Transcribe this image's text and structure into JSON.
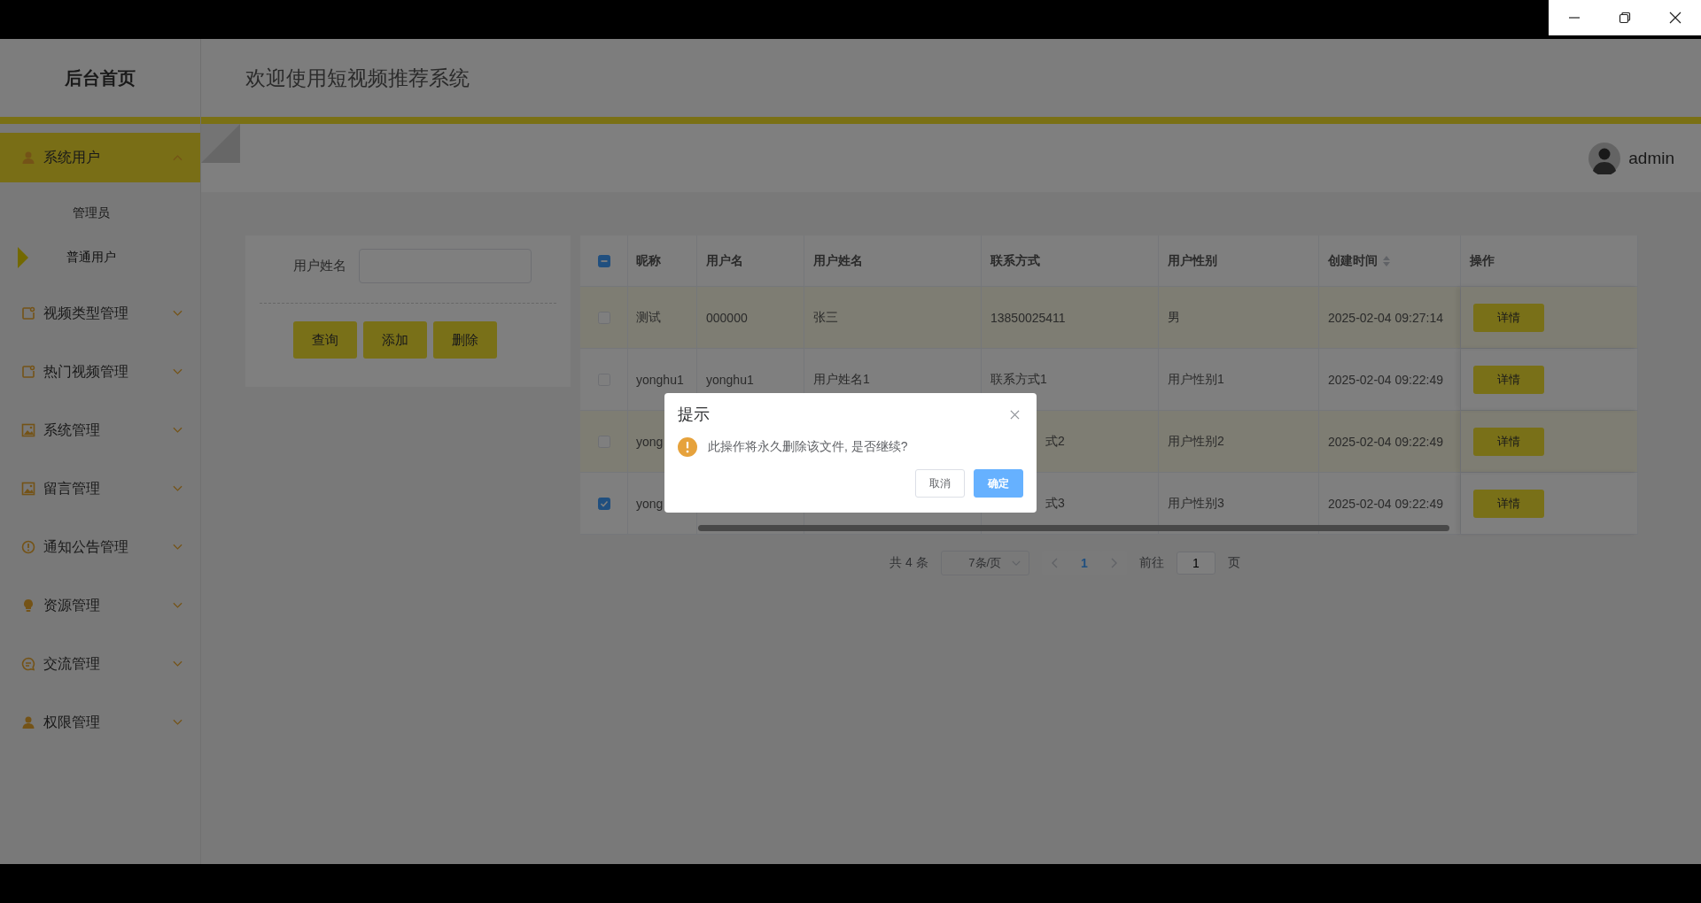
{
  "sidebar": {
    "title": "后台首页",
    "menu": [
      {
        "label": "系统用户",
        "kind": "user",
        "expanded": true,
        "selected": true,
        "children": [
          {
            "label": "管理员",
            "selected": false
          },
          {
            "label": "普通用户",
            "selected": true
          }
        ]
      },
      {
        "label": "视频类型管理",
        "kind": "note",
        "expanded": false,
        "selected": false
      },
      {
        "label": "热门视频管理",
        "kind": "note",
        "expanded": false,
        "selected": false
      },
      {
        "label": "系统管理",
        "kind": "image",
        "expanded": false,
        "selected": false
      },
      {
        "label": "留言管理",
        "kind": "image",
        "expanded": false,
        "selected": false
      },
      {
        "label": "通知公告管理",
        "kind": "alert",
        "expanded": false,
        "selected": false
      },
      {
        "label": "资源管理",
        "kind": "bulb",
        "expanded": false,
        "selected": false
      },
      {
        "label": "交流管理",
        "kind": "chat",
        "expanded": false,
        "selected": false
      },
      {
        "label": "权限管理",
        "kind": "user",
        "expanded": false,
        "selected": false
      }
    ]
  },
  "header": {
    "title": "欢迎使用短视频推荐系统",
    "user": "admin"
  },
  "search": {
    "label": "用户姓名",
    "buttons": [
      "查询",
      "添加",
      "删除"
    ]
  },
  "table": {
    "select_all": {
      "indeterminate": true
    },
    "columns": [
      {
        "label": "昵称",
        "sortable": false
      },
      {
        "label": "用户名",
        "sortable": false
      },
      {
        "label": "用户姓名",
        "sortable": false
      },
      {
        "label": "联系方式",
        "sortable": false
      },
      {
        "label": "用户性别",
        "sortable": false
      },
      {
        "label": "创建时间",
        "sortable": true
      },
      {
        "label": "操作",
        "sortable": false
      }
    ],
    "rows": [
      {
        "checked": false,
        "cells": [
          {
            "kind": "full",
            "text": "测试"
          },
          {
            "kind": "full",
            "text": "000000"
          },
          {
            "kind": "full",
            "text": "张三"
          },
          {
            "kind": "full",
            "text": "13850025411"
          },
          {
            "kind": "full",
            "text": "男"
          },
          {
            "kind": "full",
            "text": "2025-02-04 09:27:14"
          }
        ],
        "action": "详情"
      },
      {
        "checked": false,
        "cells": [
          {
            "kind": "full",
            "text": "yonghu1"
          },
          {
            "kind": "full",
            "text": "yonghu1"
          },
          {
            "kind": "full",
            "text": "用户姓名1"
          },
          {
            "kind": "full",
            "text": "联系方式1"
          },
          {
            "kind": "full",
            "text": "用户性别1"
          },
          {
            "kind": "full",
            "text": "2025-02-04 09:22:49"
          }
        ],
        "action": "详情"
      },
      {
        "checked": false,
        "cells": [
          {
            "kind": "full",
            "text": "yong"
          },
          {
            "kind": "hidden"
          },
          {
            "kind": "hidden"
          },
          {
            "kind": "tail",
            "text": "式2"
          },
          {
            "kind": "full",
            "text": "用户性别2"
          },
          {
            "kind": "full",
            "text": "2025-02-04 09:22:49"
          }
        ],
        "action": "详情"
      },
      {
        "checked": true,
        "cells": [
          {
            "kind": "full",
            "text": "yong"
          },
          {
            "kind": "hidden"
          },
          {
            "kind": "hidden"
          },
          {
            "kind": "tail",
            "text": "式3"
          },
          {
            "kind": "full",
            "text": "用户性别3"
          },
          {
            "kind": "full",
            "text": "2025-02-04 09:22:49"
          }
        ],
        "action": "详情"
      }
    ]
  },
  "pagination": {
    "total": "共 4 条",
    "page_size": "7条/页",
    "pages": [
      {
        "label": "1",
        "selected": true
      }
    ],
    "goto_label": "前往",
    "goto_value": "1",
    "goto_unit": "页"
  },
  "dialog": {
    "title": "提示",
    "message": "此操作将永久删除该文件, 是否继续?",
    "buttons": [
      {
        "label": "取消",
        "kind": "default"
      },
      {
        "label": "确定",
        "kind": "primary"
      }
    ]
  }
}
